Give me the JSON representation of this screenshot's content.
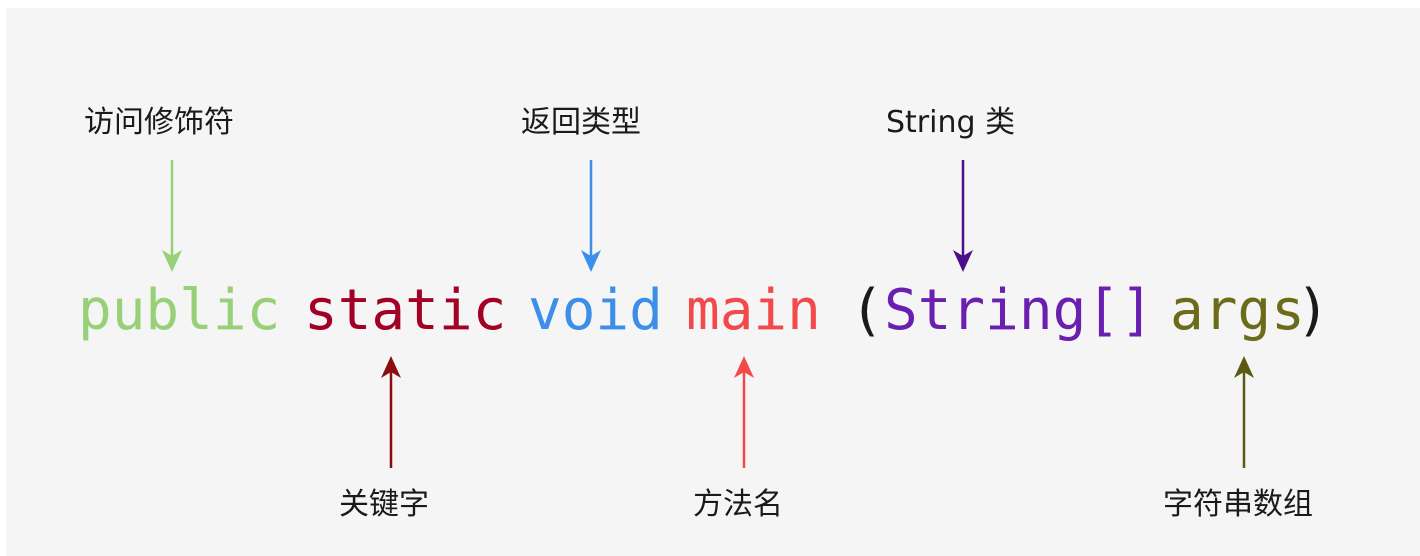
{
  "labels": {
    "access_modifier": "访问修饰符",
    "return_type": "返回类型",
    "string_class": "String 类",
    "keyword": "关键字",
    "method_name": "方法名",
    "string_array": "字符串数组"
  },
  "code": {
    "public": "public",
    "static": "static",
    "void": "void",
    "main": "main",
    "open_paren": "(",
    "string_array_type": "String[]",
    "args": "args",
    "close_paren": ")"
  },
  "colors": {
    "public": "#97d077",
    "static": "#a20025",
    "void": "#3d8ee8",
    "main": "#f24a4a",
    "paren": "#1a1a1a",
    "string_array_type": "#6a1fb0",
    "args": "#6b6b1a",
    "background": "#f5f5f5"
  }
}
